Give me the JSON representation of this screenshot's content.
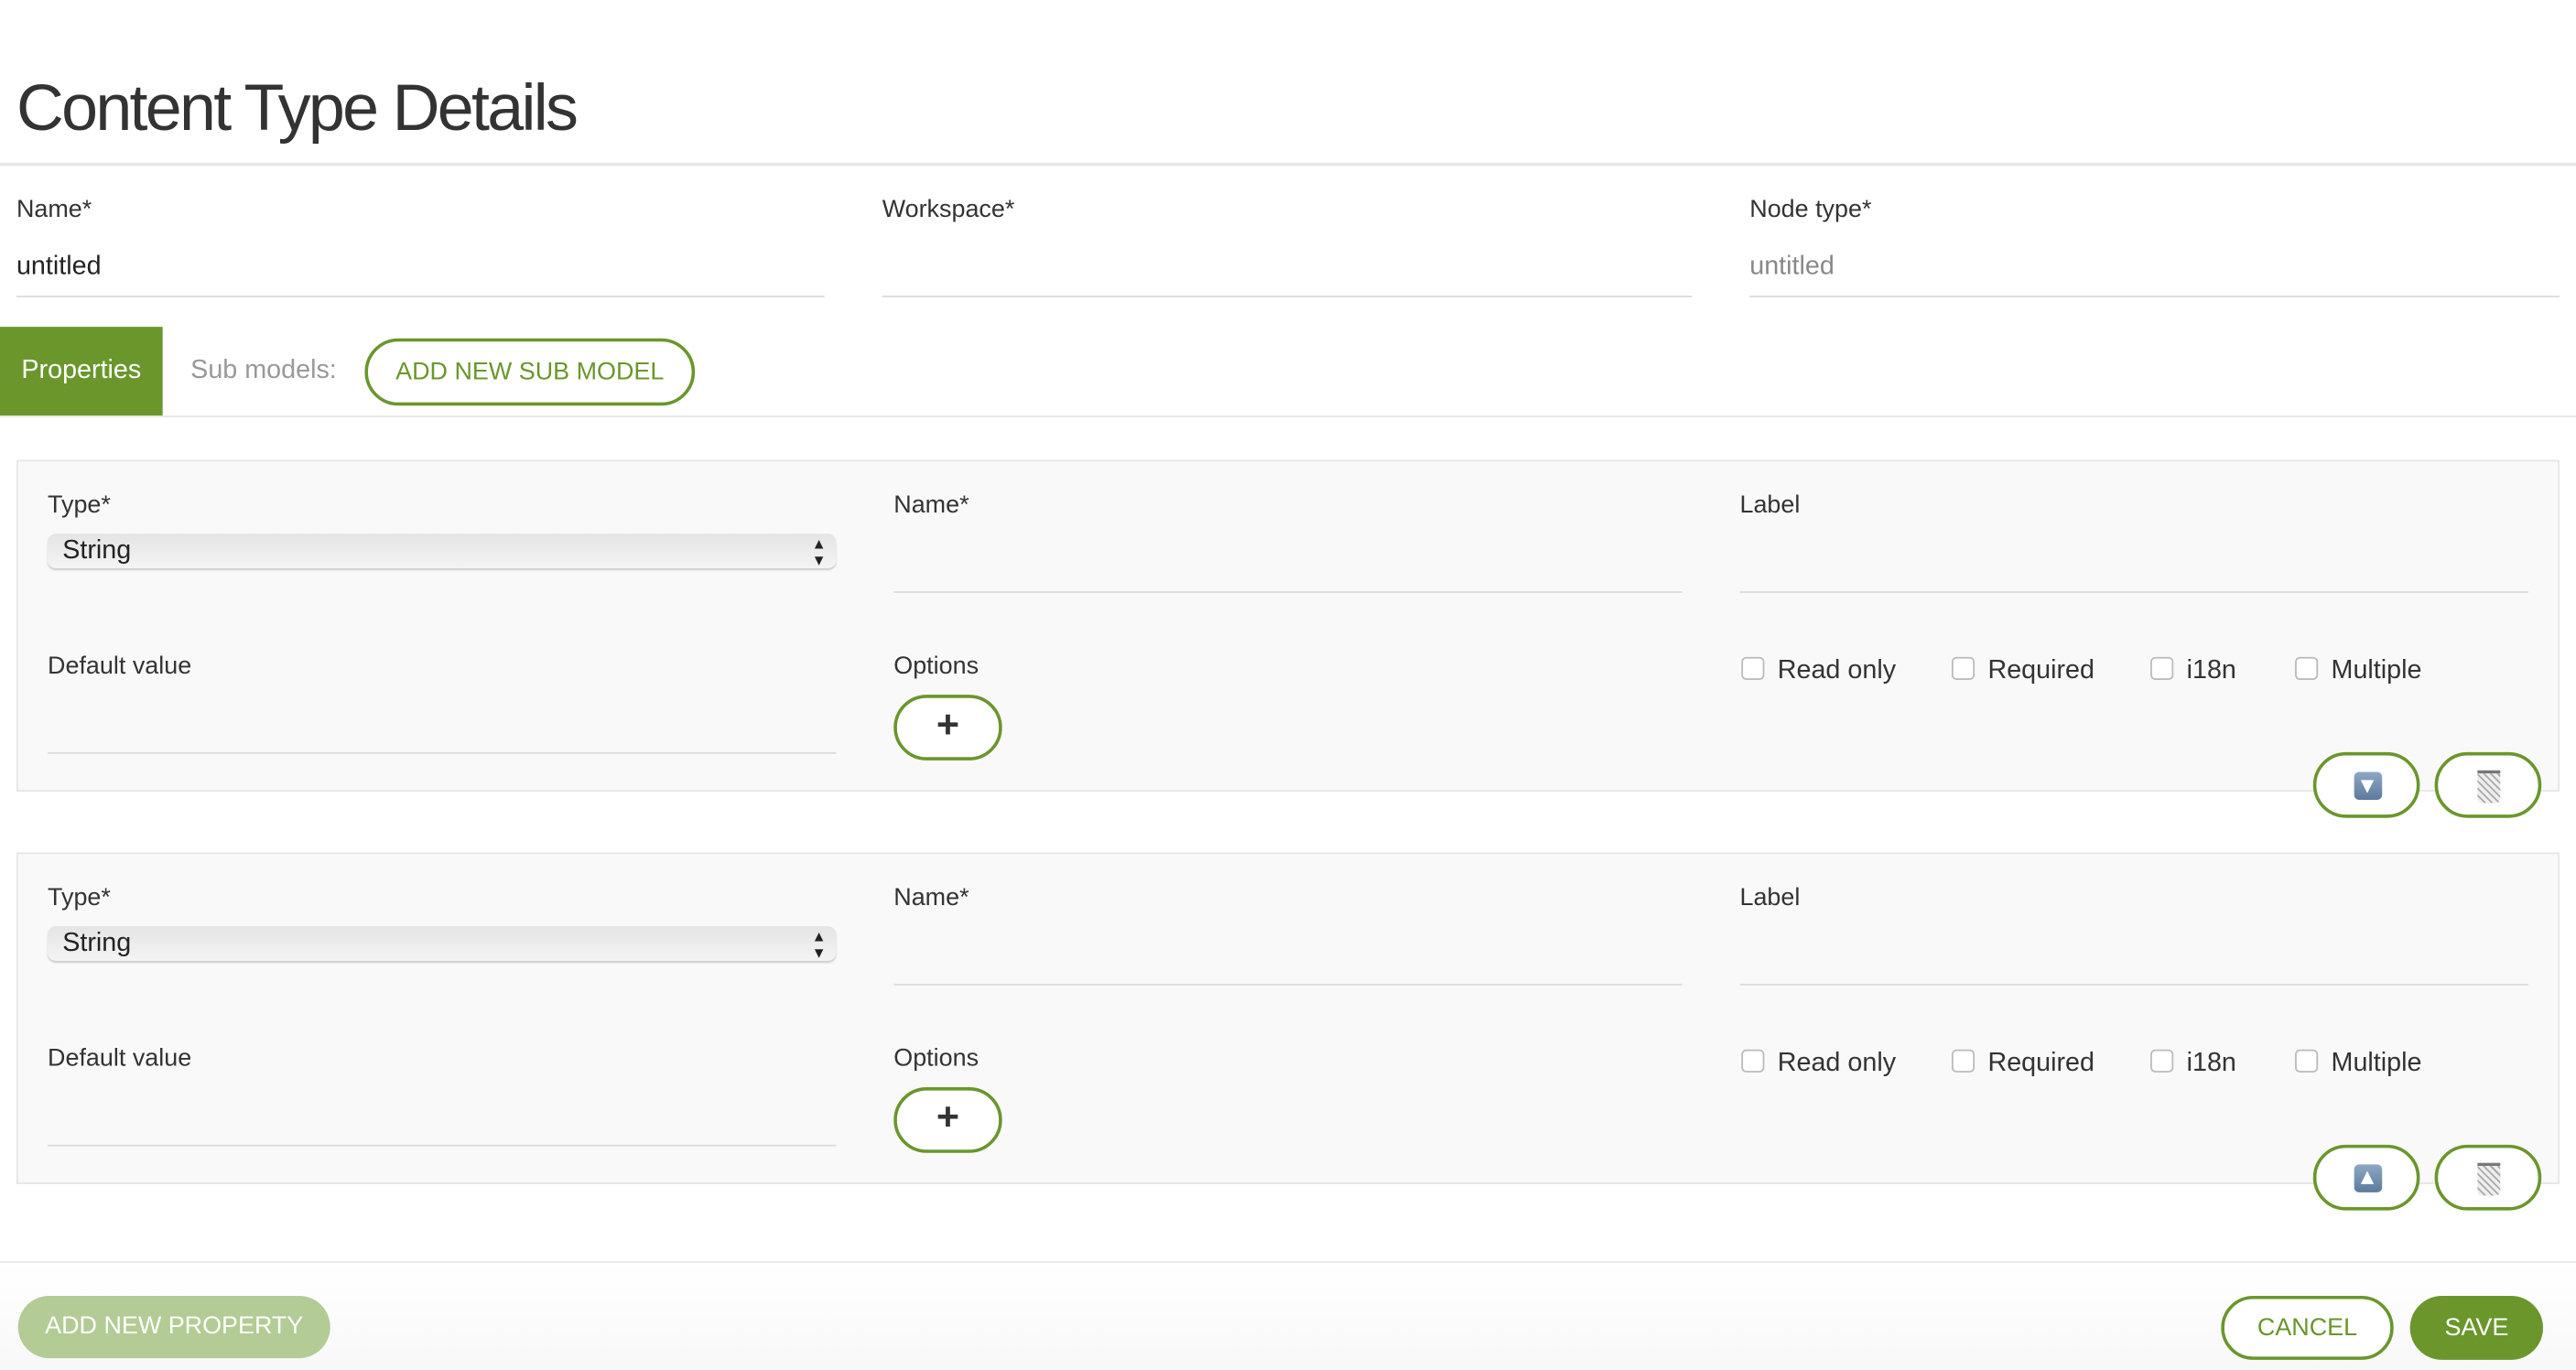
{
  "page_title": "Content Type Details",
  "header_fields": {
    "name": {
      "label": "Name*",
      "value": "untitled"
    },
    "workspace": {
      "label": "Workspace*",
      "value": ""
    },
    "node_type": {
      "label": "Node type*",
      "placeholder": "untitled"
    }
  },
  "tabs": {
    "properties": "Properties",
    "sub_models_label": "Sub models:",
    "add_sub_model": "ADD NEW SUB MODEL"
  },
  "properties": [
    {
      "type_label": "Type*",
      "type_value": "String",
      "name_label": "Name*",
      "label_label": "Label",
      "default_label": "Default value",
      "options_label": "Options",
      "add_option": "+",
      "checkboxes": [
        "Read only",
        "Required",
        "i18n",
        "Multiple"
      ],
      "move_icon": "move-down-icon"
    },
    {
      "type_label": "Type*",
      "type_value": "String",
      "name_label": "Name*",
      "label_label": "Label",
      "default_label": "Default value",
      "options_label": "Options",
      "add_option": "+",
      "checkboxes": [
        "Read only",
        "Required",
        "i18n",
        "Multiple"
      ],
      "move_icon": "move-up-icon"
    }
  ],
  "footer": {
    "add_property": "ADD NEW PROPERTY",
    "cancel": "CANCEL",
    "save": "SAVE"
  },
  "colors": {
    "accent": "#6a962c",
    "accent_light": "#b3cb95"
  }
}
